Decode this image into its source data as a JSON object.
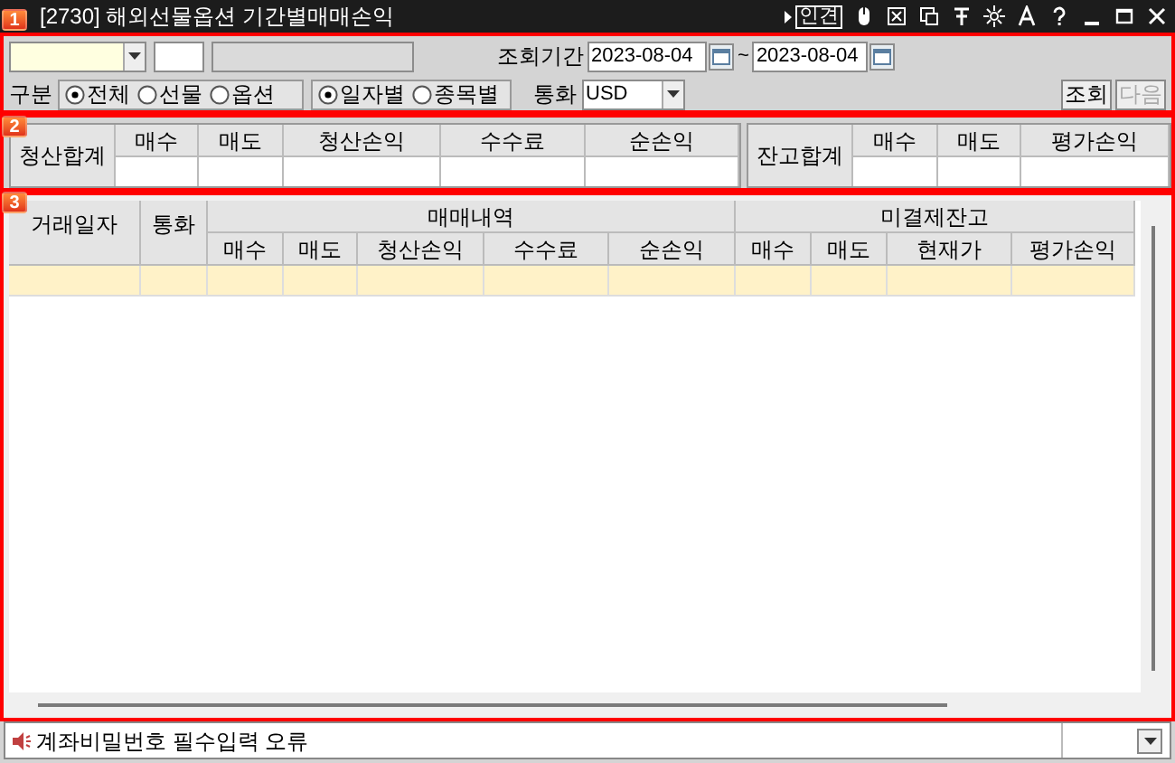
{
  "window": {
    "title": "[2730] 해외선물옵션 기간별매매손익",
    "link_button": "인견"
  },
  "section_markers": [
    "1",
    "2",
    "3"
  ],
  "query": {
    "period_label": "조회기간",
    "start_date": "2023-08-04",
    "separator": "~",
    "end_date": "2023-08-04",
    "category_label": "구분",
    "type_options": [
      {
        "label": "전체",
        "selected": true
      },
      {
        "label": "선물",
        "selected": false
      },
      {
        "label": "옵션",
        "selected": false
      }
    ],
    "view_options": [
      {
        "label": "일자별",
        "selected": true
      },
      {
        "label": "종목별",
        "selected": false
      }
    ],
    "currency_label": "통화",
    "currency": "USD",
    "buttons": [
      {
        "label": "조회",
        "disabled": false
      },
      {
        "label": "다음",
        "disabled": true
      }
    ]
  },
  "summary": {
    "label": "청산합계",
    "columns": [
      "매수",
      "매도",
      "청산손익",
      "수수료",
      "순손익"
    ],
    "balance_label": "잔고합계",
    "balance_columns": [
      "매수",
      "매도",
      "평가손익"
    ]
  },
  "table": {
    "columns": [
      "거래일자",
      "통화"
    ],
    "groups": [
      {
        "label": "매매내역",
        "columns": [
          "매수",
          "매도",
          "청산손익",
          "수수료",
          "순손익"
        ]
      },
      {
        "label": "미결제잔고",
        "columns": [
          "매수",
          "매도",
          "현재가",
          "평가손익"
        ]
      }
    ]
  },
  "status_bar": {
    "message": "계좌비밀번호 필수입력 오류"
  }
}
